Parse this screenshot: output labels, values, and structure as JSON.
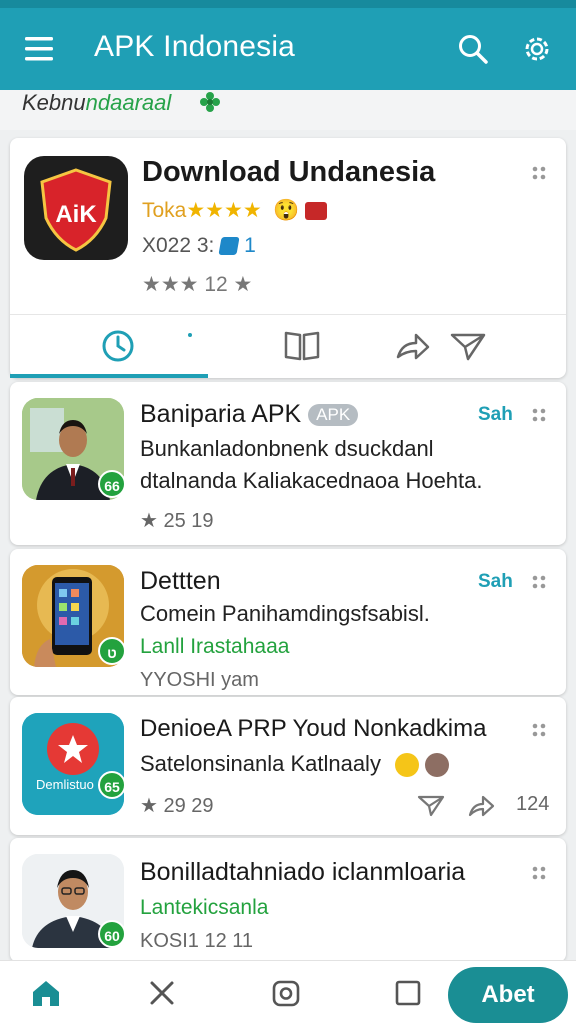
{
  "appbar": {
    "title": "APK Indonesia",
    "icons": [
      "menu-icon",
      "search-icon",
      "gear-icon"
    ]
  },
  "subheader": {
    "label_start": "Kebnu",
    "label_end": "ndaaraal",
    "icon": "flower-icon"
  },
  "featured": {
    "icon_text": "AiK",
    "title": "Download Undanesia",
    "subtitle_text": "Toka",
    "subtitle_stars": "★★★★",
    "emoji": "😲",
    "meta_text": "X022 3:",
    "meta_value": "1",
    "rating_text": "★★★ 12 ★",
    "tabs": [
      "clock-tab",
      "info-tab",
      "book-tab",
      "share-tab",
      "send-tab"
    ],
    "active_tab": 0
  },
  "items": [
    {
      "title": "Baniparia APK",
      "tag": "APK",
      "action": "Sah",
      "line1": "Bunkanladonbnenk dsuckdanl",
      "line2": "dtalnanda Kaliakacednaoa Hoehta.",
      "meta": "★ 25  19",
      "badge": "66"
    },
    {
      "title": "Dettten",
      "action": "Sah",
      "line1": "Comein Panihamdingsfsabisl.",
      "green": "Lanll Irastahaaa",
      "meta": "YYOSHI  yam",
      "badge": "ט"
    },
    {
      "title": "DenioeA PRP Youd Nonkadkima",
      "line1": "Satelonsinanla Katlnaaly",
      "meta": "★ 29  29",
      "right_count": "124",
      "thumb_label": "Demlistuo",
      "badge": "65"
    },
    {
      "title": "Bonilladtahniado iclanmloaria",
      "green": "Lantekicsanla",
      "meta": "KOSI1  12    11",
      "badge": "60"
    }
  ],
  "bottom_nav": {
    "items": [
      "home-icon",
      "close-icon",
      "camera-icon",
      "square-icon"
    ],
    "fab_label": "Abet"
  },
  "colors": {
    "primary": "#1f9fb5",
    "green": "#23a23e",
    "fab": "#1a8e94"
  }
}
